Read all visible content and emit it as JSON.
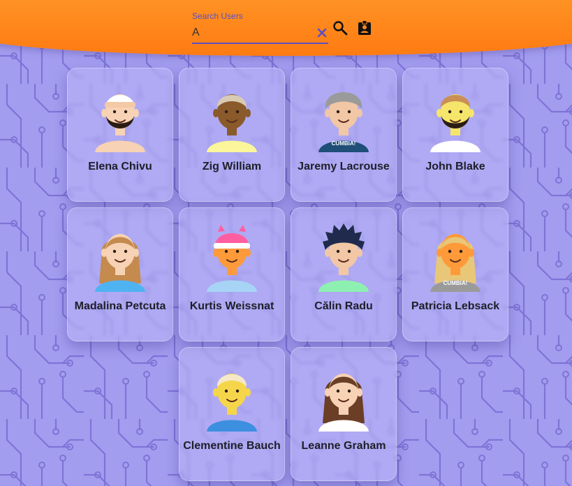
{
  "search": {
    "label": "Search Users",
    "value": "A",
    "clear_icon": "close-icon",
    "search_icon": "search-icon",
    "badge_icon": "badge-icon"
  },
  "colors": {
    "header_orange": "#ff8a1f",
    "background": "#a39df0",
    "accent": "#5a4fc2"
  },
  "users": [
    {
      "name": "Elena Chivu",
      "skin": "#f7d2b4",
      "hair": "#ffffff",
      "shirt": "#f7d2b4",
      "hair_style": "headband",
      "beard": true
    },
    {
      "name": "Zig William",
      "skin": "#8a5a2b",
      "hair": "#d9cbb3",
      "shirt": "#fbf59c",
      "hair_style": "short",
      "beard": false
    },
    {
      "name": "Jaremy Lacrouse",
      "skin": "#f2c7a5",
      "hair": "#9a9a9a",
      "shirt": "#1f4e79",
      "hair_style": "turban",
      "beard": false,
      "shirt_text": "CUMBIA!"
    },
    {
      "name": "John Blake",
      "skin": "#f5e56b",
      "hair": "#c98f55",
      "shirt": "#ffffff",
      "hair_style": "short",
      "beard": true
    },
    {
      "name": "Madalina Petcuta",
      "skin": "#f7d2b4",
      "hair": "#c48a4e",
      "shirt": "#4fb3f2",
      "hair_style": "long",
      "beard": false
    },
    {
      "name": "Kurtis Weissnat",
      "skin": "#ff9a3a",
      "hair": "#ff5fa0",
      "shirt": "#a7d4f5",
      "hair_style": "beanie",
      "beard": false
    },
    {
      "name": "Călin Radu",
      "skin": "#f2c7a5",
      "hair": "#1f2a4d",
      "shirt": "#8ef0b0",
      "hair_style": "spiky",
      "beard": false
    },
    {
      "name": "Patricia Lebsack",
      "skin": "#ff9a3a",
      "hair": "#e8c778",
      "shirt": "#9a9a9a",
      "hair_style": "long",
      "beard": false,
      "shirt_text": "CUMBIA!"
    },
    {
      "name": "Clementine Bauch",
      "skin": "#f5d64a",
      "hair": "#f5e9c8",
      "shirt": "#3d8fe0",
      "hair_style": "short",
      "beard": false
    },
    {
      "name": "Leanne Graham",
      "skin": "#f7d2b4",
      "hair": "#6b3e26",
      "shirt": "#ffffff",
      "hair_style": "long",
      "beard": false
    }
  ]
}
